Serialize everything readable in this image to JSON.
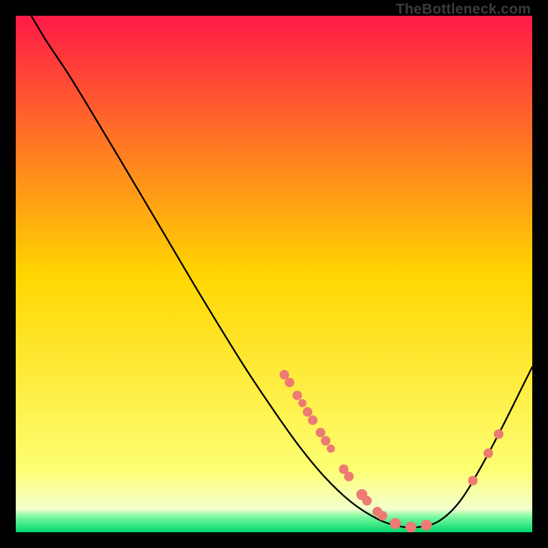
{
  "watermark": "TheBottleneck.com",
  "chart_data": {
    "type": "line",
    "title": "",
    "xlabel": "",
    "ylabel": "",
    "xlim": [
      0,
      100
    ],
    "ylim": [
      0,
      100
    ],
    "background_gradient": {
      "stops": [
        {
          "pos": 0.0,
          "color": "#ff1a47"
        },
        {
          "pos": 0.5,
          "color": "#ffd600"
        },
        {
          "pos": 0.88,
          "color": "#fdff73"
        },
        {
          "pos": 0.955,
          "color": "#f3ffcf"
        },
        {
          "pos": 0.97,
          "color": "#7cf9a0"
        },
        {
          "pos": 1.0,
          "color": "#00d66b"
        }
      ]
    },
    "curve": [
      {
        "x": 3.0,
        "y": 100.0
      },
      {
        "x": 6.0,
        "y": 95.0
      },
      {
        "x": 10.0,
        "y": 89.0
      },
      {
        "x": 14.0,
        "y": 82.5
      },
      {
        "x": 20.0,
        "y": 72.5
      },
      {
        "x": 28.0,
        "y": 59.0
      },
      {
        "x": 36.0,
        "y": 45.5
      },
      {
        "x": 44.0,
        "y": 32.5
      },
      {
        "x": 50.0,
        "y": 23.5
      },
      {
        "x": 55.0,
        "y": 16.5
      },
      {
        "x": 60.0,
        "y": 10.5
      },
      {
        "x": 65.0,
        "y": 5.8
      },
      {
        "x": 70.0,
        "y": 2.6
      },
      {
        "x": 74.0,
        "y": 1.2
      },
      {
        "x": 78.0,
        "y": 1.0
      },
      {
        "x": 82.0,
        "y": 2.2
      },
      {
        "x": 86.0,
        "y": 6.0
      },
      {
        "x": 90.0,
        "y": 12.5
      },
      {
        "x": 94.0,
        "y": 20.0
      },
      {
        "x": 98.0,
        "y": 28.0
      },
      {
        "x": 100.0,
        "y": 32.0
      }
    ],
    "markers": [
      {
        "x": 52.0,
        "y": 30.5,
        "r": 7
      },
      {
        "x": 53.0,
        "y": 29.0,
        "r": 7
      },
      {
        "x": 54.5,
        "y": 26.5,
        "r": 7
      },
      {
        "x": 55.5,
        "y": 25.0,
        "r": 6
      },
      {
        "x": 56.5,
        "y": 23.3,
        "r": 7
      },
      {
        "x": 57.5,
        "y": 21.7,
        "r": 7
      },
      {
        "x": 59.0,
        "y": 19.3,
        "r": 7
      },
      {
        "x": 60.0,
        "y": 17.7,
        "r": 7
      },
      {
        "x": 61.0,
        "y": 16.2,
        "r": 6
      },
      {
        "x": 63.5,
        "y": 12.2,
        "r": 7
      },
      {
        "x": 64.5,
        "y": 10.8,
        "r": 7
      },
      {
        "x": 67.0,
        "y": 7.3,
        "r": 8
      },
      {
        "x": 68.0,
        "y": 6.1,
        "r": 7
      },
      {
        "x": 70.0,
        "y": 4.0,
        "r": 7
      },
      {
        "x": 71.0,
        "y": 3.2,
        "r": 7
      },
      {
        "x": 73.5,
        "y": 1.7,
        "r": 8
      },
      {
        "x": 76.5,
        "y": 1.0,
        "r": 8
      },
      {
        "x": 79.5,
        "y": 1.4,
        "r": 8
      },
      {
        "x": 88.5,
        "y": 10.0,
        "r": 7
      },
      {
        "x": 91.5,
        "y": 15.3,
        "r": 7
      },
      {
        "x": 93.5,
        "y": 19.0,
        "r": 7
      }
    ],
    "marker_color": "#ed7b73"
  }
}
